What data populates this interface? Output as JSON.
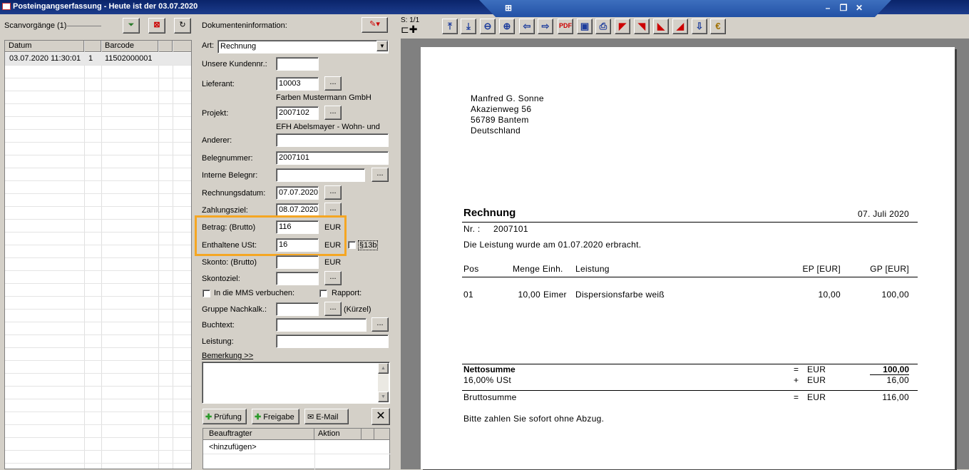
{
  "window": {
    "title": "Posteingangserfassung - Heute ist der 03.07.2020"
  },
  "left": {
    "scan_label": "Scanvorgänge (1)",
    "columns": [
      "Datum",
      "",
      "Barcode"
    ],
    "rows": [
      {
        "datum": "03.07.2020 11:30:01",
        "nr": "1",
        "barcode": "11502000001"
      }
    ]
  },
  "form": {
    "section_title": "Dokumenteninformation:",
    "art_label": "Art:",
    "art_value": "Rechnung",
    "kundennr_label": "Unsere Kundennr.:",
    "kundennr_value": "",
    "lieferant_label": "Lieferant:",
    "lieferant_value": "10003",
    "lieferant_name": "Farben Mustermann GmbH",
    "projekt_label": "Projekt:",
    "projekt_value": "2007102",
    "projekt_name": "EFH Abelsmayer - Wohn- und",
    "anderer_label": "Anderer:",
    "anderer_value": "",
    "belegnummer_label": "Belegnummer:",
    "belegnummer_value": "2007101",
    "interne_label": "Interne Belegnr:",
    "interne_value": "",
    "rechnungsdatum_label": "Rechnungsdatum:",
    "rechnungsdatum_value": "07.07.2020",
    "zahlungsziel_label": "Zahlungsziel:",
    "zahlungsziel_value": "08.07.2020",
    "betrag_label": "Betrag: (Brutto)",
    "betrag_value": "116",
    "ust_label": "Enthaltene USt:",
    "ust_value": "16",
    "skonto_label": "Skonto: (Brutto)",
    "skonto_value": "",
    "skontoziel_label": "Skontoziel:",
    "skontoziel_value": "",
    "currency": "EUR",
    "s13b_label": "§13b",
    "mms_label": "In die MMS verbuchen:",
    "rapport_label": "Rapport:",
    "gruppe_label": "Gruppe Nachkalk.:",
    "gruppe_value": "",
    "kuerzel_label": "(Kürzel)",
    "buchtext_label": "Buchtext:",
    "buchtext_value": "",
    "leistung_label": "Leistung:",
    "leistung_value": "",
    "bemerkung_link": "Bemerkung >>",
    "pruefung_label": "Prüfung",
    "freigabe_label": "Freigabe",
    "email_label": "E-Mail",
    "beauftragter_col": "Beauftragter",
    "aktion_col": "Aktion",
    "hinzufuegen": "<hinzufügen>",
    "dots": "..."
  },
  "viewer": {
    "page_indicator": "S: 1/1"
  },
  "document": {
    "address": [
      "Manfred G. Sonne",
      "Akazienweg 56",
      "56789 Bantem",
      "Deutschland"
    ],
    "title": "Rechnung",
    "date": "07. Juli 2020",
    "nr_label": "Nr. :",
    "nr_value": "2007101",
    "service_text": "Die Leistung wurde am 01.07.2020 erbracht.",
    "table_headers": {
      "pos": "Pos",
      "menge": "Menge Einh.",
      "leistung": "Leistung",
      "ep": "EP [EUR]",
      "gp": "GP [EUR]"
    },
    "items": [
      {
        "pos": "01",
        "menge": "10,00",
        "einh": "Eimer",
        "leistung": "Dispersionsfarbe weiß",
        "ep": "10,00",
        "gp": "100,00"
      }
    ],
    "netto_label": "Nettosumme",
    "netto_op": "=",
    "netto_cur": "EUR",
    "netto_value": "100,00",
    "ust_label": "16,00% USt",
    "ust_op": "+",
    "ust_cur": "EUR",
    "ust_value": "16,00",
    "brutto_label": "Bruttosumme",
    "brutto_op": "=",
    "brutto_cur": "EUR",
    "brutto_value": "116,00",
    "payment_text": "Bitte zahlen Sie sofort ohne Abzug."
  }
}
